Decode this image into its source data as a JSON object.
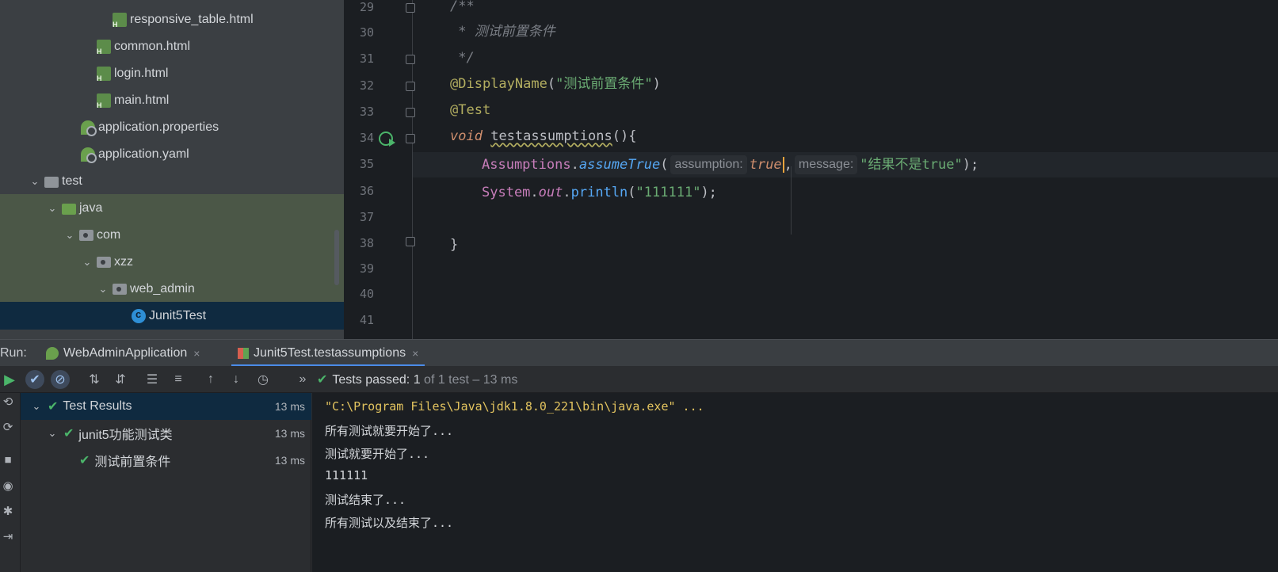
{
  "tree": {
    "items": [
      {
        "label": "responsive_table.html",
        "icon": "html-file-icon"
      },
      {
        "label": "common.html",
        "icon": "html-file-icon"
      },
      {
        "label": "login.html",
        "icon": "html-file-icon"
      },
      {
        "label": "main.html",
        "icon": "html-file-icon"
      },
      {
        "label": "application.properties",
        "icon": "spring-config-icon"
      },
      {
        "label": "application.yaml",
        "icon": "spring-config-icon"
      },
      {
        "label": "test",
        "icon": "folder-icon"
      },
      {
        "label": "java",
        "icon": "folder-icon"
      },
      {
        "label": "com",
        "icon": "package-icon"
      },
      {
        "label": "xzz",
        "icon": "package-icon"
      },
      {
        "label": "web_admin",
        "icon": "package-icon"
      },
      {
        "label": "Junit5Test",
        "icon": "class-icon"
      }
    ]
  },
  "editor": {
    "line_numbers": [
      "29",
      "30",
      "31",
      "32",
      "33",
      "34",
      "35",
      "36",
      "37",
      "38",
      "39",
      "40",
      "41"
    ],
    "code": {
      "l29": "/**",
      "l30": " * 测试前置条件",
      "l31": " */",
      "l32_ann": "@DisplayName",
      "l32_open": "(",
      "l32_str": "\"测试前置条件\"",
      "l32_close": ")",
      "l33": "@Test",
      "l34_kw": "void",
      "l34_name": "testassumptions",
      "l34_rest": "(){",
      "l35_cls": "Assumptions",
      "l35_dot": ".",
      "l35_method": "assumeTrue",
      "l35_open": "(",
      "l35_hint1": "assumption:",
      "l35_val": "true",
      "l35_comma": ",",
      "l35_hint2": "message:",
      "l35_str": "\"结果不是true\"",
      "l35_end": ");",
      "l36_cls": "System",
      "l36_dot1": ".",
      "l36_field": "out",
      "l36_dot2": ".",
      "l36_method": "println",
      "l36_open": "(",
      "l36_str": "\"111111\"",
      "l36_end": ");",
      "l38": "}"
    }
  },
  "run": {
    "label": "Run:",
    "tabs": [
      {
        "label": "WebAdminApplication",
        "close": "×"
      },
      {
        "label": "Junit5Test.testassumptions",
        "close": "×"
      }
    ],
    "status": {
      "text": "Tests passed:",
      "count": "1",
      "detail": "of 1 test – 13 ms"
    },
    "more": "»",
    "results": [
      {
        "label": "Test Results",
        "duration": "13 ms"
      },
      {
        "label": "junit5功能测试类",
        "duration": "13 ms"
      },
      {
        "label": "测试前置条件",
        "duration": "13 ms"
      }
    ],
    "console": [
      "\"C:\\Program Files\\Java\\jdk1.8.0_221\\bin\\java.exe\" ...",
      "所有测试就要开始了...",
      "测试就要开始了...",
      "111111",
      "测试结束了...",
      "所有测试以及结束了..."
    ]
  },
  "colors": {
    "accent": "#4a8be8",
    "success": "#4bb56a",
    "selection": "#0f2a40",
    "tree_highlight": "#4b5747"
  }
}
